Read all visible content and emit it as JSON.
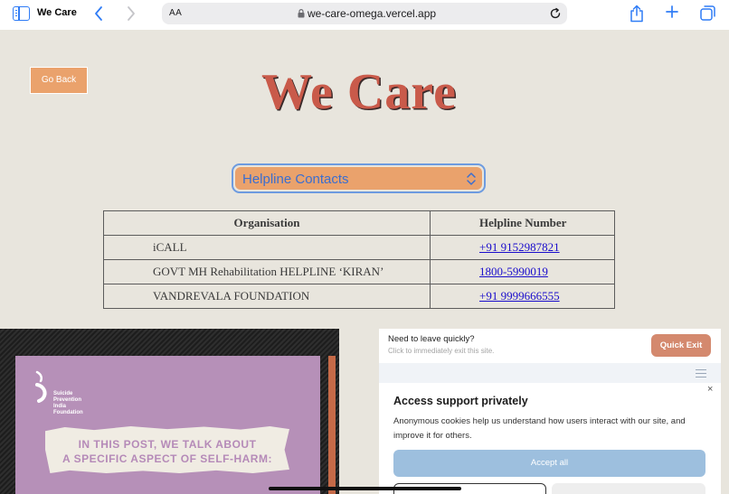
{
  "browser": {
    "tab_title": "We Care",
    "text_size_label": "AA",
    "url": "we-care-omega.vercel.app"
  },
  "page": {
    "go_back_label": "Go Back",
    "title": "We Care",
    "select_value": "Helpline Contacts"
  },
  "table": {
    "headers": [
      "Organisation",
      "Helpline Number"
    ],
    "rows": [
      {
        "org": "iCALL",
        "number": "+91 9152987821"
      },
      {
        "org": "GOVT MH Rehabilitation HELPLINE ‘KIRAN’",
        "number": "1800-5990019"
      },
      {
        "org": "VANDREVALA FOUNDATION",
        "number": "+91 9999666555"
      }
    ]
  },
  "image_post": {
    "org_name": [
      "Suicide",
      "Prevention",
      "India",
      "Foundation"
    ],
    "caption_lines": [
      "IN THIS POST, WE TALK ABOUT",
      "A SPECIFIC ASPECT OF SELF-HARM:"
    ]
  },
  "quick_exit": {
    "title": "Need to leave quickly?",
    "subtitle": "Click to immediately exit this site.",
    "button_label": "Quick Exit"
  },
  "cookie_panel": {
    "close_glyph": "×",
    "title": "Access support privately",
    "body": "Anonymous cookies help us understand how users interact with our site, and improve it for others.",
    "accept_label": "Accept all"
  },
  "colors": {
    "accent_orange": "#eaa26c",
    "title_red": "#c95a4a",
    "link_blue": "#1a0dcc",
    "page_bg": "#e8e5dd"
  }
}
